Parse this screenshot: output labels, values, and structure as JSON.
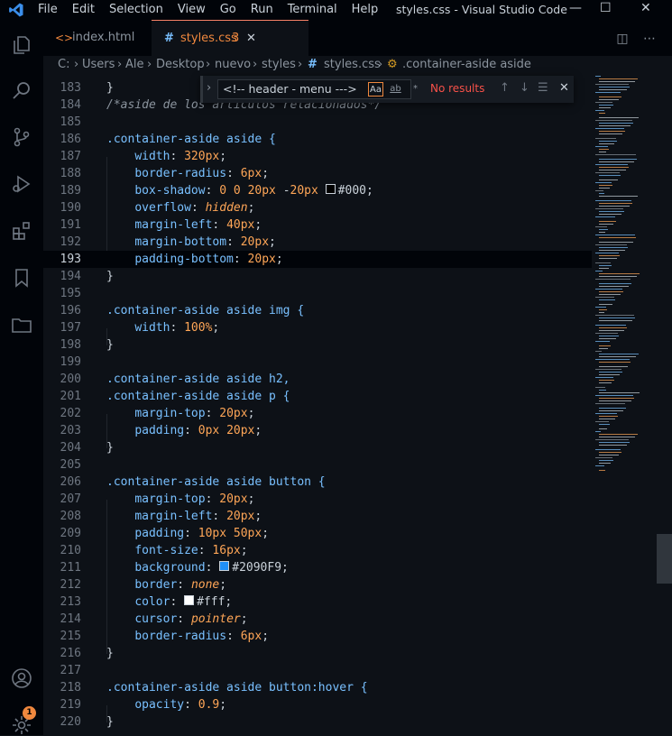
{
  "titlebar": {
    "menu": [
      "File",
      "Edit",
      "Selection",
      "View",
      "Go",
      "Run",
      "Terminal",
      "Help"
    ],
    "title": "styles.css - Visual Studio Code"
  },
  "tabs": [
    {
      "label": "index.html",
      "icon": "html-chevrons-icon"
    },
    {
      "label": "styles.css",
      "badge": "3",
      "icon": "css-hash-icon"
    }
  ],
  "breadcrumb": [
    "C:",
    "Users",
    "Ale",
    "Desktop",
    "nuevo",
    "styles",
    "styles.css",
    ".container-aside aside"
  ],
  "find": {
    "query": "<!-- header - menu --->",
    "status": "No results",
    "options": [
      "Aa",
      "ab",
      "*"
    ]
  },
  "activity_badge": "1",
  "colors": {
    "accent": "#f0883e",
    "swatch_blue": "#2090F9",
    "swatch_black": "#000",
    "swatch_white": "#fff"
  },
  "lines": [
    {
      "n": "183",
      "t": "}"
    },
    {
      "n": "184",
      "t": "/*aside de los articulos relacionados*/"
    },
    {
      "n": "185",
      "t": ""
    },
    {
      "n": "186",
      "t": ".container-aside aside {"
    },
    {
      "n": "187",
      "t": "    width: 320px;"
    },
    {
      "n": "188",
      "t": "    border-radius: 6px;"
    },
    {
      "n": "189",
      "t": "    box-shadow: 0 0 20px -20px #000;"
    },
    {
      "n": "190",
      "t": "    overflow: hidden;"
    },
    {
      "n": "191",
      "t": "    margin-left: 40px;"
    },
    {
      "n": "192",
      "t": "    margin-bottom: 20px;"
    },
    {
      "n": "193",
      "t": "    padding-bottom: 20px;"
    },
    {
      "n": "194",
      "t": "}"
    },
    {
      "n": "195",
      "t": ""
    },
    {
      "n": "196",
      "t": ".container-aside aside img {"
    },
    {
      "n": "197",
      "t": "    width: 100%;"
    },
    {
      "n": "198",
      "t": "}"
    },
    {
      "n": "199",
      "t": ""
    },
    {
      "n": "200",
      "t": ".container-aside aside h2,"
    },
    {
      "n": "201",
      "t": ".container-aside aside p {"
    },
    {
      "n": "202",
      "t": "    margin-top: 20px;"
    },
    {
      "n": "203",
      "t": "    padding: 0px 20px;"
    },
    {
      "n": "204",
      "t": "}"
    },
    {
      "n": "205",
      "t": ""
    },
    {
      "n": "206",
      "t": ".container-aside aside button {"
    },
    {
      "n": "207",
      "t": "    margin-top: 20px;"
    },
    {
      "n": "208",
      "t": "    margin-left: 20px;"
    },
    {
      "n": "209",
      "t": "    padding: 10px 50px;"
    },
    {
      "n": "210",
      "t": "    font-size: 16px;"
    },
    {
      "n": "211",
      "t": "    background: #2090F9;"
    },
    {
      "n": "212",
      "t": "    border: none;"
    },
    {
      "n": "213",
      "t": "    color: #fff;"
    },
    {
      "n": "214",
      "t": "    cursor: pointer;"
    },
    {
      "n": "215",
      "t": "    border-radius: 6px;"
    },
    {
      "n": "216",
      "t": "}"
    },
    {
      "n": "217",
      "t": ""
    },
    {
      "n": "218",
      "t": ".container-aside aside button:hover {"
    },
    {
      "n": "219",
      "t": "    opacity: 0.9;"
    },
    {
      "n": "220",
      "t": "}"
    }
  ]
}
